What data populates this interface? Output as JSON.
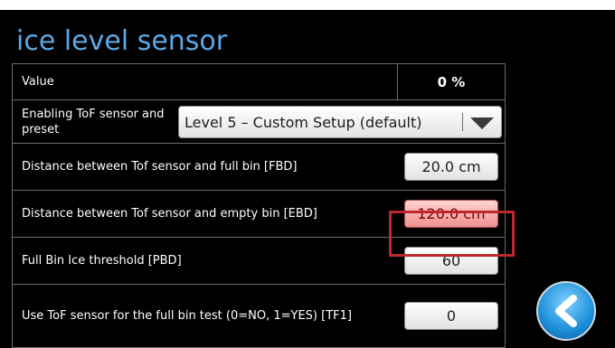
{
  "title": "ice level sensor",
  "rows": {
    "value": {
      "label": "Value",
      "value": "0 %"
    },
    "preset": {
      "label": "Enabling ToF sensor and preset",
      "selected": "Level 5 – Custom Setup (default)"
    },
    "fbd": {
      "label": "Distance between Tof sensor and full bin [FBD]",
      "value": "20.0 cm"
    },
    "ebd": {
      "label": "Distance between Tof sensor and empty bin [EBD]",
      "value": "120.0 cm"
    },
    "pbd": {
      "label": "Full Bin Ice threshold [PBD]",
      "value": "60"
    },
    "tf1": {
      "label": "Use ToF sensor for the full bin test (0=NO, 1=YES) [TF1]",
      "value": "0"
    }
  },
  "colors": {
    "title": "#5aa9e6",
    "highlight": "#c0272d",
    "active_button": "#f08f8f",
    "back_button": "#1c8fd8"
  },
  "icons": {
    "dropdown": "chevron-down-icon",
    "back": "back-arrow-icon"
  }
}
